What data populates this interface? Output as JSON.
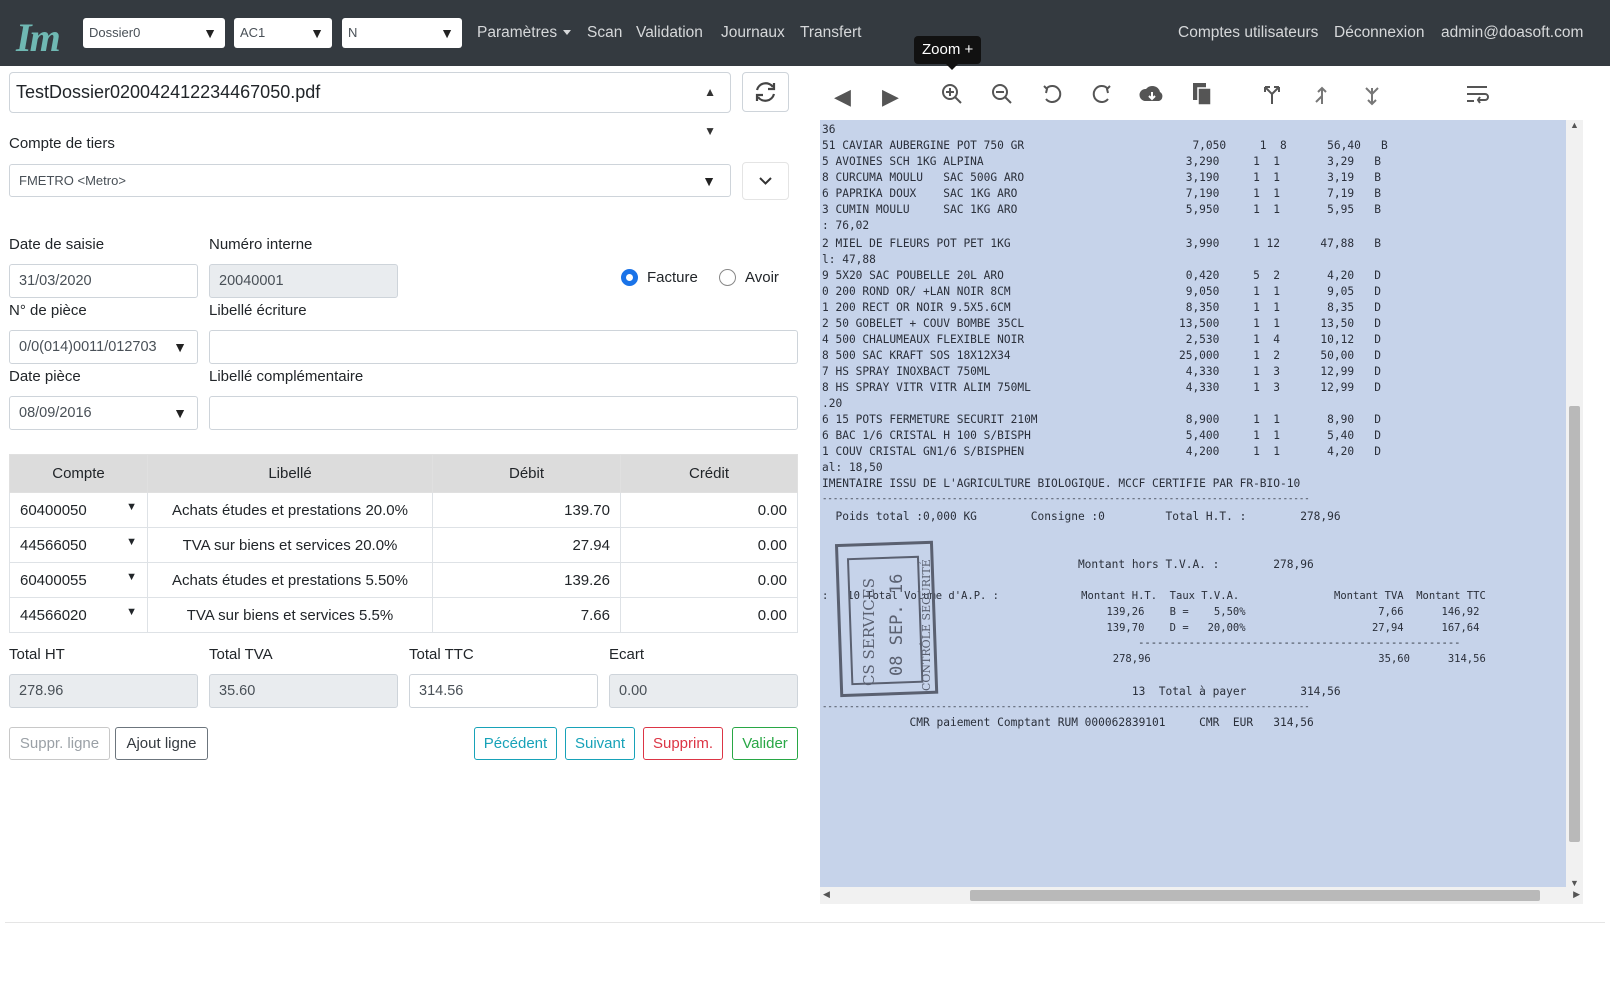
{
  "navbar": {
    "logo": "Im",
    "dossier": "Dossier0",
    "ac": "AC1",
    "n": "N",
    "links": [
      "Paramètres",
      "Scan",
      "Validation",
      "Journaux",
      "Transfert"
    ],
    "right_links": [
      "Comptes utilisateurs",
      "Déconnexion",
      "admin@doasoft.com"
    ]
  },
  "form": {
    "file": "TestDossier020042412234467050.pdf",
    "compte_tiers_label": "Compte de tiers",
    "compte_tiers_value": "FMETRO <Metro>",
    "date_saisie_label": "Date de saisie",
    "date_saisie": "31/03/2020",
    "numero_interne_label": "Numéro interne",
    "numero_interne": "20040001",
    "facture_label": "Facture",
    "avoir_label": "Avoir",
    "piece_label": "N° de pièce",
    "piece": "0/0(014)0011/012703",
    "libelle_ecriture_label": "Libellé écriture",
    "libelle_ecriture": "",
    "date_piece_label": "Date pièce",
    "date_piece": "08/09/2016",
    "libelle_comp_label": "Libellé complémentaire",
    "libelle_comp": ""
  },
  "table": {
    "headers": [
      "Compte",
      "Libellé",
      "Débit",
      "Crédit"
    ],
    "rows": [
      {
        "compte": "60400050",
        "libelle": "Achats études et prestations 20.0%",
        "debit": "139.70",
        "credit": "0.00"
      },
      {
        "compte": "44566050",
        "libelle": "TVA sur biens et services 20.0%",
        "debit": "27.94",
        "credit": "0.00"
      },
      {
        "compte": "60400055",
        "libelle": "Achats études et prestations 5.50%",
        "debit": "139.26",
        "credit": "0.00"
      },
      {
        "compte": "44566020",
        "libelle": "TVA sur biens et services 5.5%",
        "debit": "7.66",
        "credit": "0.00"
      }
    ]
  },
  "totals": {
    "ht_label": "Total HT",
    "ht": "278.96",
    "tva_label": "Total TVA",
    "tva": "35.60",
    "ttc_label": "Total TTC",
    "ttc": "314.56",
    "ecart_label": "Ecart",
    "ecart": "0.00"
  },
  "buttons": {
    "suppr_ligne": "Suppr. ligne",
    "ajout_ligne": "Ajout ligne",
    "precedent": "Pécédent",
    "suivant": "Suivant",
    "supprim": "Supprim.",
    "valider": "Valider"
  },
  "colors": {
    "navbar": "#343a40",
    "info": "#17a2b8",
    "danger": "#dc3545",
    "success": "#28a745",
    "radio": "#1a73e8"
  },
  "viewer": {
    "tooltip": "Zoom +",
    "lines": [
      "36",
      "51 CAVIAR AUBERGINE POT 750 GR                         7,050     1  8      56,40   B",
      "5 AVOINES SCH 1KG ALPINA                              3,290     1  1       3,29   B",
      "8 CURCUMA MOULU   SAC 500G ARO                        3,190     1  1       3,19   B",
      "6 PAPRIKA DOUX    SAC 1KG ARO                         7,190     1  1       7,19   B",
      "3 CUMIN MOULU     SAC 1KG ARO                         5,950     1  1       5,95   B",
      ": 76,02",
      "2 MIEL DE FLEURS POT PET 1KG                          3,990     1 12      47,88   B",
      "l: 47,88",
      "9 5X20 SAC POUBELLE 20L ARO                           0,420     5  2       4,20   D",
      "0 200 ROND OR/ +LAN NOIR 8CM                          9,050     1  1       9,05   D",
      "1 200 RECT OR NOIR 9.5X5.6CM                          8,350     1  1       8,35   D",
      "2 50 GOBELET + COUV BOMBE 35CL                       13,500     1  1      13,50   D",
      "4 500 CHALUMEAUX FLEXIBLE NOIR                        2,530     1  4      10,12   D",
      "8 500 SAC KRAFT SOS 18X12X34                         25,000     1  2      50,00   D",
      "7 HS SPRAY INOXBACT 750ML                             4,330     1  3      12,99   D",
      "8 HS SPRAY VITR VITR ALIM 750ML                       4,330     1  3      12,99   D",
      ".20",
      "6 15 POTS FERMETURE SECURIT 210M                      8,900     1  1       8,90   D",
      "6 BAC 1/6 CRISTAL H 100 S/BISPH                       5,400     1  1       5,40   D",
      "1 COUV CRISTAL GN1/6 S/BISPHEN                        4,200     1  1       4,20   D",
      "al: 18,50",
      "IMENTAIRE ISSU DE L'AGRICULTURE BIOLOGIQUE. MCCF CERTIFIE PAR FR-BIO-10",
      "------------------------------------------------------------------------------------------",
      "  Poids total :0,000 KG        Consigne :0         Total H.T. :        278,96",
      "                                      Montant hors T.V.A. :        278,96",
      ":   10 Total Volume d'A.P. :             Montant H.T.  Taux T.V.A.               Montant TVA  Montant TTC",
      "                                             139,26    B =    5,50%                     7,66      146,92",
      "                                             139,70    D =   20,00%                    27,94      167,64",
      "                                                  ---------------------------------------------------",
      "                                              278,96                                    35,60      314,56",
      "                                              13  Total à payer        314,56",
      "------------------------------------------------------------------------------------------",
      "             CMR paiement Comptant RUM 000062839101     CMR  EUR   314,56"
    ],
    "stamp": "CS SERVICES 08 SEP. 16 CONTRÔLE SÉCURITÉ"
  }
}
